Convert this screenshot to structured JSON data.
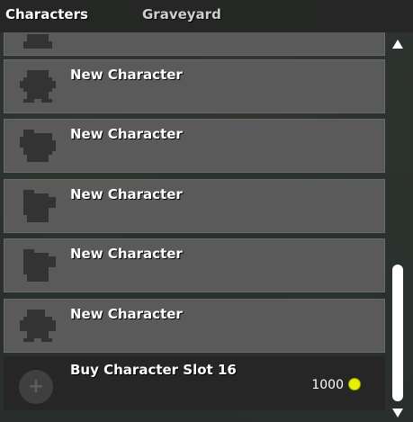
{
  "tabs": [
    {
      "label": "Characters",
      "active": true
    },
    {
      "label": "Graveyard",
      "active": false
    }
  ],
  "slots": [
    {
      "name": ""
    },
    {
      "name": "New Character"
    },
    {
      "name": "New Character"
    },
    {
      "name": "New Character"
    },
    {
      "name": "New Character"
    },
    {
      "name": "New Character"
    }
  ],
  "buy_slot": {
    "label": "Buy Character Slot 16",
    "price": "1000",
    "icon": "plus-icon",
    "currency_icon": "gold-coin-icon"
  },
  "scrollbar": {
    "up_icon": "arrow-up-icon",
    "down_icon": "arrow-down-icon"
  },
  "colors": {
    "coin": "#e6f000",
    "slot_bg": "#5a5a5a",
    "buy_bg": "#262626"
  }
}
